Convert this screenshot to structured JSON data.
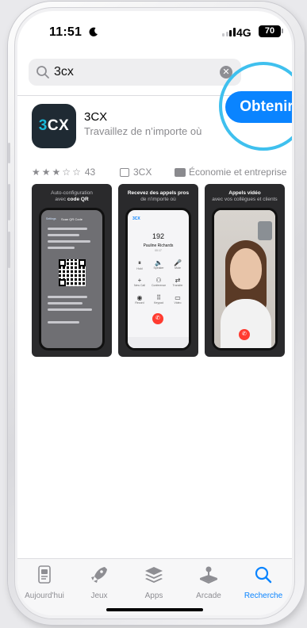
{
  "status_bar": {
    "time": "11:51",
    "network": "4G",
    "battery": "70"
  },
  "search": {
    "query": "3cx"
  },
  "app": {
    "name": "3CX",
    "subtitle": "Travaillez de n’importe où",
    "icon_text": "CX",
    "icon_digit": "3",
    "get_label": "Obtenir",
    "rating_stars": 3,
    "rating_count": "43",
    "developer": "3CX",
    "category": "Économie et entreprise"
  },
  "screenshots": [
    {
      "caption_line1": "Auto-configuration",
      "caption_line2_prefix": "avec ",
      "caption_line2_bold": "code QR",
      "screen_title": "Scan QR Code",
      "back_label": "Settings"
    },
    {
      "caption_line1_bold": "Recevez des appels pros",
      "caption_line2": "de n'importe où",
      "dialer_number": "192",
      "contact_name": "Pauline Richards",
      "contact_ext": "00:17",
      "logo": "3CX",
      "keys": [
        {
          "glyph": "⏸",
          "label": "Hold"
        },
        {
          "glyph": "🔈",
          "label": "Speaker"
        },
        {
          "glyph": "🎤",
          "label": "Mute"
        },
        {
          "glyph": "+",
          "label": "New Call"
        },
        {
          "glyph": "⚇",
          "label": "Conference"
        },
        {
          "glyph": "⇄",
          "label": "Transfer"
        },
        {
          "glyph": "◉",
          "label": "Record"
        },
        {
          "glyph": "⠿",
          "label": "Keypad"
        },
        {
          "glyph": "▭",
          "label": "Video"
        }
      ]
    },
    {
      "caption_line1_bold": "Appels vidéo",
      "caption_line2": "avec vos collègues et clients"
    }
  ],
  "tabs": [
    {
      "label": "Aujourd'hui",
      "icon": "today-icon",
      "active": false
    },
    {
      "label": "Jeux",
      "icon": "rocket-icon",
      "active": false
    },
    {
      "label": "Apps",
      "icon": "layers-icon",
      "active": false
    },
    {
      "label": "Arcade",
      "icon": "joystick-icon",
      "active": false
    },
    {
      "label": "Recherche",
      "icon": "search-icon",
      "active": true
    }
  ],
  "colors": {
    "accent": "#0a84ff",
    "highlight_ring": "#3fc0ee",
    "icon_bg": "#1f2a33",
    "icon_digit": "#19b6d6"
  }
}
